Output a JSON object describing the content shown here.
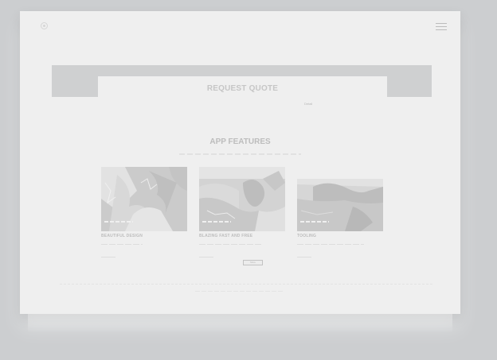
{
  "header": {
    "logo_icon": "circle-logo-icon",
    "menu_icon": "hamburger-menu-icon"
  },
  "hero": {
    "title": "REQUEST QUOTE",
    "small_link": "Detail"
  },
  "features_section": {
    "title": "APP FEATURES",
    "items": [
      {
        "title": "BEAUTIFUL DESIGN"
      },
      {
        "title": "BLAZING FAST AND FREE"
      },
      {
        "title": "TOOLING"
      }
    ],
    "more_button_label": "More"
  }
}
